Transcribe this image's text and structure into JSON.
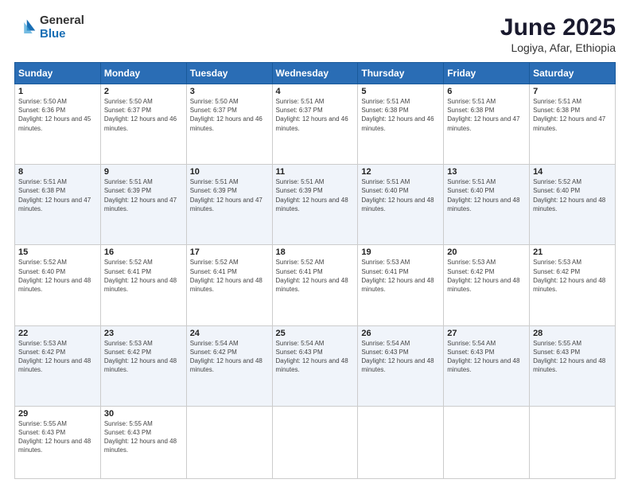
{
  "logo": {
    "line1": "General",
    "line2": "Blue"
  },
  "title": "June 2025",
  "subtitle": "Logiya, Afar, Ethiopia",
  "days_header": [
    "Sunday",
    "Monday",
    "Tuesday",
    "Wednesday",
    "Thursday",
    "Friday",
    "Saturday"
  ],
  "weeks": [
    [
      {
        "num": "1",
        "sunrise": "5:50 AM",
        "sunset": "6:36 PM",
        "daylight": "12 hours and 45 minutes."
      },
      {
        "num": "2",
        "sunrise": "5:50 AM",
        "sunset": "6:37 PM",
        "daylight": "12 hours and 46 minutes."
      },
      {
        "num": "3",
        "sunrise": "5:50 AM",
        "sunset": "6:37 PM",
        "daylight": "12 hours and 46 minutes."
      },
      {
        "num": "4",
        "sunrise": "5:51 AM",
        "sunset": "6:37 PM",
        "daylight": "12 hours and 46 minutes."
      },
      {
        "num": "5",
        "sunrise": "5:51 AM",
        "sunset": "6:38 PM",
        "daylight": "12 hours and 46 minutes."
      },
      {
        "num": "6",
        "sunrise": "5:51 AM",
        "sunset": "6:38 PM",
        "daylight": "12 hours and 47 minutes."
      },
      {
        "num": "7",
        "sunrise": "5:51 AM",
        "sunset": "6:38 PM",
        "daylight": "12 hours and 47 minutes."
      }
    ],
    [
      {
        "num": "8",
        "sunrise": "5:51 AM",
        "sunset": "6:38 PM",
        "daylight": "12 hours and 47 minutes."
      },
      {
        "num": "9",
        "sunrise": "5:51 AM",
        "sunset": "6:39 PM",
        "daylight": "12 hours and 47 minutes."
      },
      {
        "num": "10",
        "sunrise": "5:51 AM",
        "sunset": "6:39 PM",
        "daylight": "12 hours and 47 minutes."
      },
      {
        "num": "11",
        "sunrise": "5:51 AM",
        "sunset": "6:39 PM",
        "daylight": "12 hours and 48 minutes."
      },
      {
        "num": "12",
        "sunrise": "5:51 AM",
        "sunset": "6:40 PM",
        "daylight": "12 hours and 48 minutes."
      },
      {
        "num": "13",
        "sunrise": "5:51 AM",
        "sunset": "6:40 PM",
        "daylight": "12 hours and 48 minutes."
      },
      {
        "num": "14",
        "sunrise": "5:52 AM",
        "sunset": "6:40 PM",
        "daylight": "12 hours and 48 minutes."
      }
    ],
    [
      {
        "num": "15",
        "sunrise": "5:52 AM",
        "sunset": "6:40 PM",
        "daylight": "12 hours and 48 minutes."
      },
      {
        "num": "16",
        "sunrise": "5:52 AM",
        "sunset": "6:41 PM",
        "daylight": "12 hours and 48 minutes."
      },
      {
        "num": "17",
        "sunrise": "5:52 AM",
        "sunset": "6:41 PM",
        "daylight": "12 hours and 48 minutes."
      },
      {
        "num": "18",
        "sunrise": "5:52 AM",
        "sunset": "6:41 PM",
        "daylight": "12 hours and 48 minutes."
      },
      {
        "num": "19",
        "sunrise": "5:53 AM",
        "sunset": "6:41 PM",
        "daylight": "12 hours and 48 minutes."
      },
      {
        "num": "20",
        "sunrise": "5:53 AM",
        "sunset": "6:42 PM",
        "daylight": "12 hours and 48 minutes."
      },
      {
        "num": "21",
        "sunrise": "5:53 AM",
        "sunset": "6:42 PM",
        "daylight": "12 hours and 48 minutes."
      }
    ],
    [
      {
        "num": "22",
        "sunrise": "5:53 AM",
        "sunset": "6:42 PM",
        "daylight": "12 hours and 48 minutes."
      },
      {
        "num": "23",
        "sunrise": "5:53 AM",
        "sunset": "6:42 PM",
        "daylight": "12 hours and 48 minutes."
      },
      {
        "num": "24",
        "sunrise": "5:54 AM",
        "sunset": "6:42 PM",
        "daylight": "12 hours and 48 minutes."
      },
      {
        "num": "25",
        "sunrise": "5:54 AM",
        "sunset": "6:43 PM",
        "daylight": "12 hours and 48 minutes."
      },
      {
        "num": "26",
        "sunrise": "5:54 AM",
        "sunset": "6:43 PM",
        "daylight": "12 hours and 48 minutes."
      },
      {
        "num": "27",
        "sunrise": "5:54 AM",
        "sunset": "6:43 PM",
        "daylight": "12 hours and 48 minutes."
      },
      {
        "num": "28",
        "sunrise": "5:55 AM",
        "sunset": "6:43 PM",
        "daylight": "12 hours and 48 minutes."
      }
    ],
    [
      {
        "num": "29",
        "sunrise": "5:55 AM",
        "sunset": "6:43 PM",
        "daylight": "12 hours and 48 minutes."
      },
      {
        "num": "30",
        "sunrise": "5:55 AM",
        "sunset": "6:43 PM",
        "daylight": "12 hours and 48 minutes."
      },
      null,
      null,
      null,
      null,
      null
    ]
  ]
}
